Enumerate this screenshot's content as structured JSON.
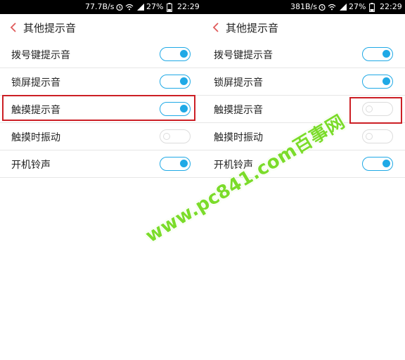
{
  "colors": {
    "accent": "#1fa9e6",
    "highlight": "#cc1f25",
    "back_arrow": "#e05a5a",
    "watermark": "#7bdc2a"
  },
  "screens": [
    {
      "status": {
        "speed": "77.7B/s",
        "battery": "27%",
        "time": "22:29"
      },
      "title": "其他提示音",
      "settings": [
        {
          "label": "拨号键提示音",
          "state": "on"
        },
        {
          "label": "锁屏提示音",
          "state": "on"
        },
        {
          "label": "触摸提示音",
          "state": "on"
        },
        {
          "label": "触摸时振动",
          "state": "off"
        },
        {
          "label": "开机铃声",
          "state": "on"
        }
      ]
    },
    {
      "status": {
        "speed": "381B/s",
        "battery": "27%",
        "time": "22:29"
      },
      "title": "其他提示音",
      "settings": [
        {
          "label": "拨号键提示音",
          "state": "on"
        },
        {
          "label": "锁屏提示音",
          "state": "on"
        },
        {
          "label": "触摸提示音",
          "state": "off"
        },
        {
          "label": "触摸时振动",
          "state": "off"
        },
        {
          "label": "开机铃声",
          "state": "on"
        }
      ]
    }
  ],
  "watermark": "www.pc841.com百事网"
}
